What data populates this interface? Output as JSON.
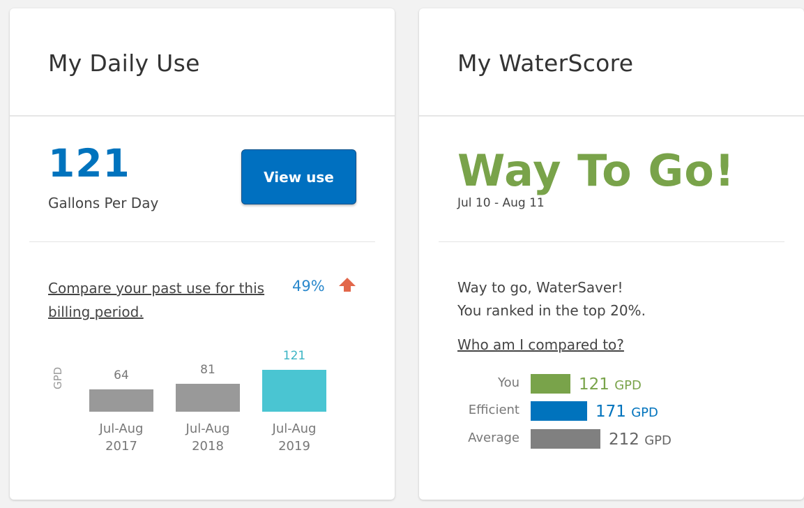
{
  "daily_use": {
    "title": "My Daily Use",
    "value": "121",
    "value_label": "Gallons Per Day",
    "view_button": "View use",
    "compare_link": "Compare your past use for this billing period.",
    "change_percent": "49%",
    "change_direction": "up",
    "colors": {
      "accent": "#0073bd",
      "arrow": "#e2674a",
      "past_bar": "#999999",
      "current_bar": "#4ac5d2"
    },
    "chart_data": {
      "type": "bar",
      "ylabel": "GPD",
      "categories": [
        {
          "line1": "Jul-Aug",
          "line2": "2017"
        },
        {
          "line1": "Jul-Aug",
          "line2": "2018"
        },
        {
          "line1": "Jul-Aug",
          "line2": "2019"
        }
      ],
      "values": [
        64,
        81,
        121
      ],
      "value_labels": [
        "64",
        "81",
        "121"
      ]
    }
  },
  "water_score": {
    "title": "My WaterScore",
    "headline": "Way To Go!",
    "date_range": "Jul 10 - Aug 11",
    "message_line1": "Way to go, WaterSaver!",
    "message_line2": "You ranked in the top 20%.",
    "who_link": "Who am I compared to?",
    "comparison": [
      {
        "label": "You",
        "value": 121,
        "value_text": "121",
        "unit": "GPD",
        "color": "#79a34a"
      },
      {
        "label": "Efficient",
        "value": 171,
        "value_text": "171",
        "unit": "GPD",
        "color": "#0073bd"
      },
      {
        "label": "Average",
        "value": 212,
        "value_text": "212",
        "unit": "GPD",
        "color": "#808080"
      }
    ]
  }
}
